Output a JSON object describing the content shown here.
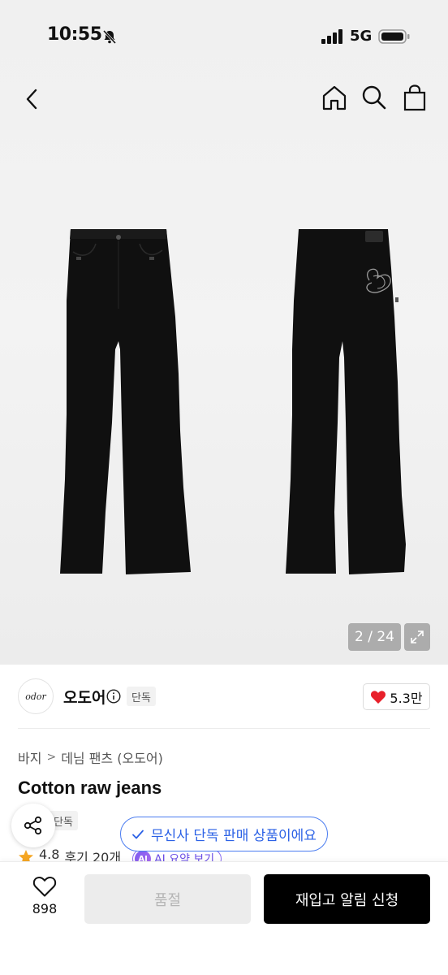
{
  "status_bar": {
    "time": "10:55",
    "network": "5G"
  },
  "gallery": {
    "counter": "2 / 24"
  },
  "brand": {
    "logo_text": "odor",
    "name": "오도어",
    "tag": "단독"
  },
  "likes": {
    "count": "5.3만"
  },
  "breadcrumb": {
    "items": [
      "바지",
      "데님 팬츠 (오도어)"
    ]
  },
  "product": {
    "title": "Cotton raw jeans",
    "exclusive_tag": "단독"
  },
  "exclusive_notice": "무신사 단독 판매 상품이에요",
  "rating": {
    "score": "4.8",
    "reviews": "후기 20개",
    "ai_badge": "AI",
    "ai_summary": "AI 요약 보기"
  },
  "bottom": {
    "wish_count": "898",
    "size_button": "품절",
    "notify_button": "재입고 알림 신청"
  },
  "colors": {
    "accent_blue": "#2b61e6",
    "heart_red": "#e8202a",
    "ai_purple": "#6b4ee6",
    "star": "#f5a623"
  }
}
